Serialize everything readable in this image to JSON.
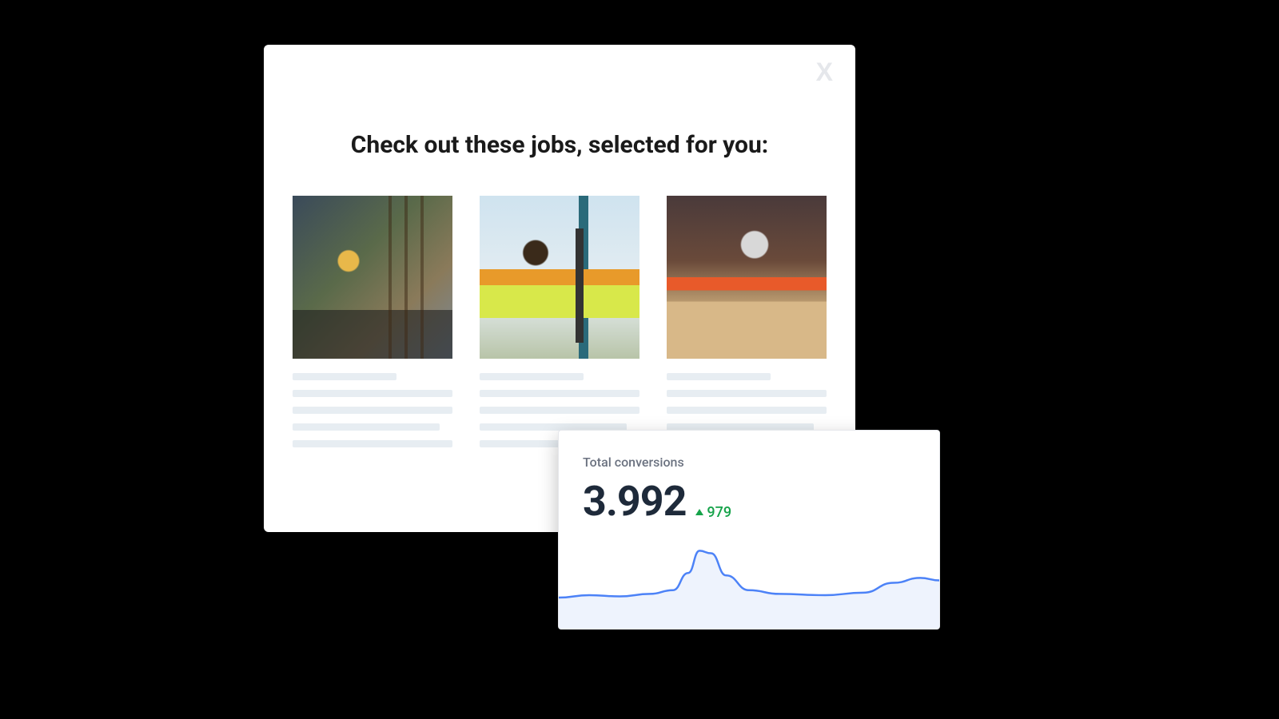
{
  "modal": {
    "close_label": "X",
    "title": "Check out these jobs, selected for you:",
    "cards": [
      {
        "image_name": "construction-worker-rebar"
      },
      {
        "image_name": "surveyor-with-theodolite"
      },
      {
        "image_name": "carpenter-sawing-wood"
      }
    ]
  },
  "metric": {
    "label": "Total conversions",
    "value": "3.992",
    "delta": "979",
    "delta_direction": "up"
  },
  "chart_data": {
    "type": "area",
    "x": [
      0,
      0.08,
      0.16,
      0.24,
      0.3,
      0.34,
      0.37,
      0.4,
      0.44,
      0.5,
      0.58,
      0.7,
      0.8,
      0.88,
      0.95,
      1.0
    ],
    "values": [
      22,
      24,
      23,
      25,
      28,
      42,
      60,
      58,
      40,
      28,
      25,
      24,
      26,
      34,
      38,
      36
    ],
    "ylim": [
      0,
      70
    ],
    "stroke": "#4c82f7",
    "fill": "#eef3fd"
  }
}
